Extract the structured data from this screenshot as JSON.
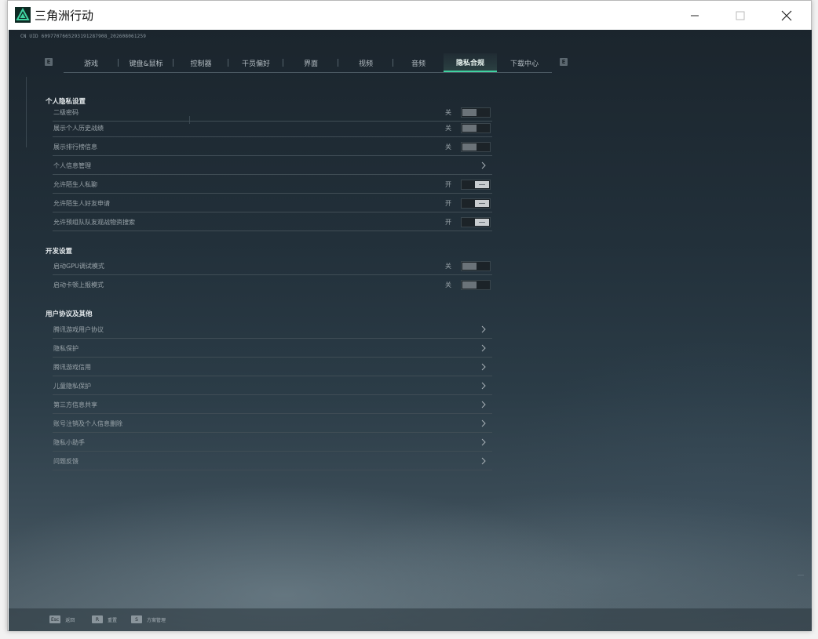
{
  "window": {
    "title": "三角洲行动",
    "accent": "#3fd2a0"
  },
  "build_info": "CN UID 6097707665293191287908_202608061259",
  "tabs": [
    {
      "label": "游戏",
      "active": false
    },
    {
      "label": "键盘&鼠标",
      "active": false
    },
    {
      "label": "控制器",
      "active": false
    },
    {
      "label": "干员偏好",
      "active": false
    },
    {
      "label": "界面",
      "active": false
    },
    {
      "label": "视频",
      "active": false
    },
    {
      "label": "音频",
      "active": false
    },
    {
      "label": "隐私合规",
      "active": true
    },
    {
      "label": "下载中心",
      "active": false
    }
  ],
  "tab_keys": {
    "prev": "E",
    "next": "E"
  },
  "sections": {
    "personal": {
      "title": "个人隐私设置",
      "rows": [
        {
          "label": "二级密码",
          "state": "关",
          "type": "toggle",
          "on": false
        },
        {
          "label": "展示个人历史战绩",
          "state": "关",
          "type": "toggle",
          "on": false
        },
        {
          "label": "展示排行榜信息",
          "state": "关",
          "type": "toggle",
          "on": false
        },
        {
          "label": "个人信息管理",
          "type": "link"
        },
        {
          "label": "允许陌生人私聊",
          "state": "开",
          "type": "toggle",
          "on": true
        },
        {
          "label": "允许陌生人好友申请",
          "state": "开",
          "type": "toggle",
          "on": true
        },
        {
          "label": "允许预组队队友观战物资搜索",
          "state": "开",
          "type": "toggle",
          "on": true
        }
      ]
    },
    "dev": {
      "title": "开发设置",
      "rows": [
        {
          "label": "启动GPU调试模式",
          "state": "关",
          "type": "toggle",
          "on": false
        },
        {
          "label": "启动卡顿上报模式",
          "state": "关",
          "type": "toggle",
          "on": false
        }
      ]
    },
    "agreements": {
      "title": "用户协议及其他",
      "rows": [
        {
          "label": "腾讯游戏用户协议",
          "type": "link"
        },
        {
          "label": "隐私保护",
          "type": "link"
        },
        {
          "label": "腾讯游戏信用",
          "type": "link"
        },
        {
          "label": "儿童隐私保护",
          "type": "link"
        },
        {
          "label": "第三方信息共享",
          "type": "link"
        },
        {
          "label": "账号注销及个人信息删除",
          "type": "link"
        },
        {
          "label": "隐私小助手",
          "type": "link"
        },
        {
          "label": "问题反馈",
          "type": "link"
        }
      ]
    }
  },
  "footer": [
    {
      "key": "Esc",
      "label": "返回"
    },
    {
      "key": "R",
      "label": "重置"
    },
    {
      "key": "S",
      "label": "方案管理"
    }
  ]
}
